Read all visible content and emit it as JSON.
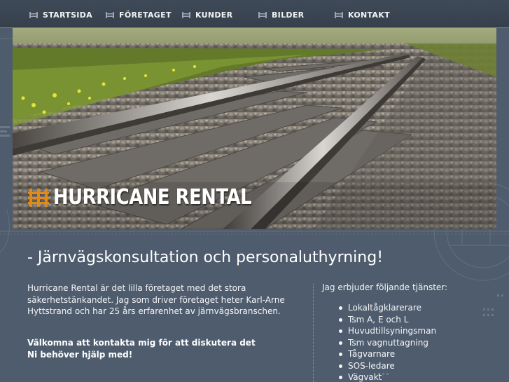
{
  "nav": {
    "items": [
      {
        "label": "STARTSIDA"
      },
      {
        "label": "FÖRETAGET"
      },
      {
        "label": "KUNDER"
      },
      {
        "label": "BILDER"
      },
      {
        "label": "KONTAKT"
      }
    ]
  },
  "logo": {
    "text": "HURRICANE RENTAL"
  },
  "tagline": "- Järnvägskonsultation och personaluthyrning!",
  "intro": {
    "text": "Hurricane Rental är det lilla företaget med det stora\nsäkerhetstänkandet. Jag som driver företaget heter Karl-Arne\nHyttstrand och har 25 års erfarenhet av järnvägsbranschen.",
    "contact": "Välkomna att kontakta mig för att diskutera det\nNi behöver hjälp med!"
  },
  "services": {
    "title": "Jag erbjuder följande tjänster:",
    "items": [
      "Lokaltågklarerare",
      "Tsm A, E och L",
      "Huvudtillsyningsman",
      "Tsm vagnuttagning",
      "Tågvarnare",
      "SOS-ledare",
      "Vägvakt"
    ]
  },
  "colors": {
    "background": "#4e5c6d",
    "nav": "#3a4451",
    "logo_icon": "#e08a1c"
  }
}
